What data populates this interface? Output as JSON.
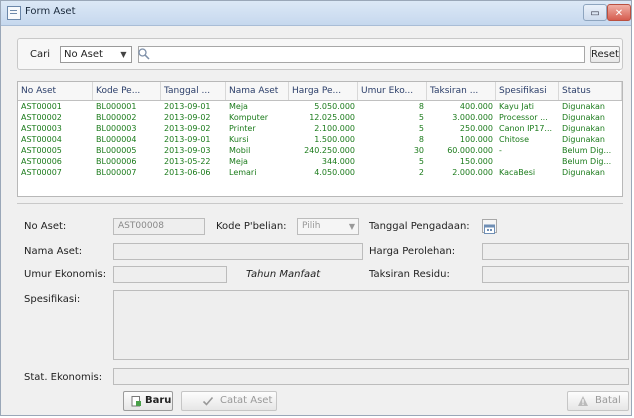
{
  "window": {
    "title": "Form Aset"
  },
  "filter": {
    "cari_label": "Cari",
    "field_selected": "No Aset",
    "search_value": "",
    "reset_label": "Reset"
  },
  "table": {
    "columns": [
      "No Aset",
      "Kode Pe...",
      "Tanggal ...",
      "Nama Aset",
      "Harga Pe...",
      "Umur Eko...",
      "Taksiran ...",
      "Spesifikasi",
      "Status"
    ],
    "rows": [
      [
        "AST00001",
        "BL000001",
        "2013-09-01",
        "Meja",
        "5.050.000",
        "8",
        "400.000",
        "Kayu Jati",
        "Digunakan"
      ],
      [
        "AST00002",
        "BL000002",
        "2013-09-02",
        "Komputer",
        "12.025.000",
        "5",
        "3.000.000",
        "Processor ...",
        "Digunakan"
      ],
      [
        "AST00003",
        "BL000003",
        "2013-09-02",
        "Printer",
        "2.100.000",
        "5",
        "250.000",
        "Canon IP17...",
        "Digunakan"
      ],
      [
        "AST00004",
        "BL000004",
        "2013-09-01",
        "Kursi",
        "1.500.000",
        "8",
        "100.000",
        "Chitose",
        "Digunakan"
      ],
      [
        "AST00005",
        "BL000005",
        "2013-09-03",
        "Mobil",
        "240.250.000",
        "30",
        "60.000.000",
        "-",
        "Belum Dig..."
      ],
      [
        "AST00006",
        "BL000006",
        "2013-05-22",
        "Meja",
        "344.000",
        "5",
        "150.000",
        "",
        "Belum Dig..."
      ],
      [
        "AST00007",
        "BL000007",
        "2013-06-06",
        "Lemari",
        "4.050.000",
        "2",
        "2.000.000",
        "KacaBesi",
        "Digunakan"
      ]
    ]
  },
  "form": {
    "no_aset_label": "No Aset:",
    "no_aset_value": "AST00008",
    "kode_pbelian_label": "Kode P'belian:",
    "kode_pbelian_value": "Pilih",
    "tanggal_label": "Tanggal Pengadaan:",
    "nama_aset_label": "Nama Aset:",
    "harga_label": "Harga Perolehan:",
    "umur_label": "Umur Ekonomis:",
    "tahun_manfaat_label": "Tahun Manfaat",
    "taksiran_label": "Taksiran Residu:",
    "spesifikasi_label": "Spesifikasi:",
    "stat_ekonomis_label": "Stat. Ekonomis:"
  },
  "actions": {
    "baru_label": "Baru",
    "catat_label": "Catat Aset",
    "batal_label": "Batal"
  },
  "colors": {
    "row_text": "#1b7b1b",
    "header_text": "#2b3e69"
  }
}
